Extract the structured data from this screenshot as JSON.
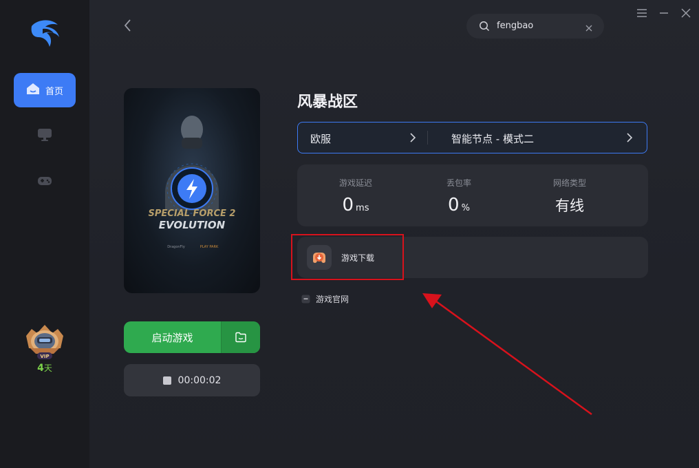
{
  "sidebar": {
    "home_label": "首页",
    "vip": {
      "badge": "VIP",
      "days_value": "4",
      "days_unit": "天"
    }
  },
  "search": {
    "value": "fengbao"
  },
  "game": {
    "title": "风暴战区",
    "cover": {
      "logo_line1": "SPECIAL FORCE 2",
      "logo_line2": "EVOLUTION",
      "publishers": [
        "DragonFly",
        "PLAY PARK"
      ]
    }
  },
  "server": {
    "region": "欧服",
    "node": "智能节点 - 模式二"
  },
  "stats": [
    {
      "key": "游戏延迟",
      "value": "0",
      "unit": "ms"
    },
    {
      "key": "丢包率",
      "value": "0",
      "unit": "%"
    },
    {
      "key": "网络类型",
      "value": "有线",
      "unit": ""
    }
  ],
  "actions": {
    "download_label": "游戏下载",
    "official_label": "游戏官网"
  },
  "buttons": {
    "start_label": "启动游戏",
    "timer": "00:00:02"
  },
  "colors": {
    "accent": "#3d7bf5",
    "start": "#2faa4f",
    "annotation": "#d8121c",
    "vip_days": "#7cd34a"
  }
}
